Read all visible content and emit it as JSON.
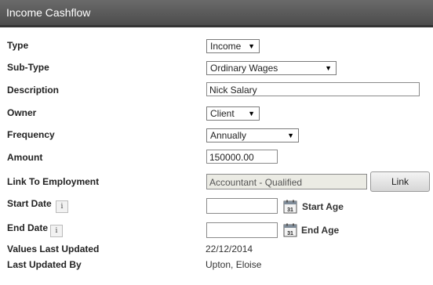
{
  "panel": {
    "title": "Income Cashflow"
  },
  "fields": {
    "type": {
      "label": "Type",
      "value": "Income"
    },
    "sub_type": {
      "label": "Sub-Type",
      "value": "Ordinary Wages"
    },
    "description": {
      "label": "Description",
      "value": "Nick Salary"
    },
    "owner": {
      "label": "Owner",
      "value": "Client"
    },
    "frequency": {
      "label": "Frequency",
      "value": "Annually"
    },
    "amount": {
      "label": "Amount",
      "value": "150000.00"
    },
    "link_employment": {
      "label": "Link To Employment",
      "value": "Accountant - Qualified",
      "button": "Link"
    },
    "start_date": {
      "label": "Start Date",
      "value": "",
      "age_label": "Start Age",
      "info": "i"
    },
    "end_date": {
      "label": "End Date",
      "value": "",
      "age_label": "End Age",
      "info": "i"
    },
    "values_last_updated": {
      "label": "Values Last Updated",
      "value": "22/12/2014"
    },
    "last_updated_by": {
      "label": "Last Updated By",
      "value": "Upton, Eloise"
    }
  },
  "calendar_icon_text": "31"
}
